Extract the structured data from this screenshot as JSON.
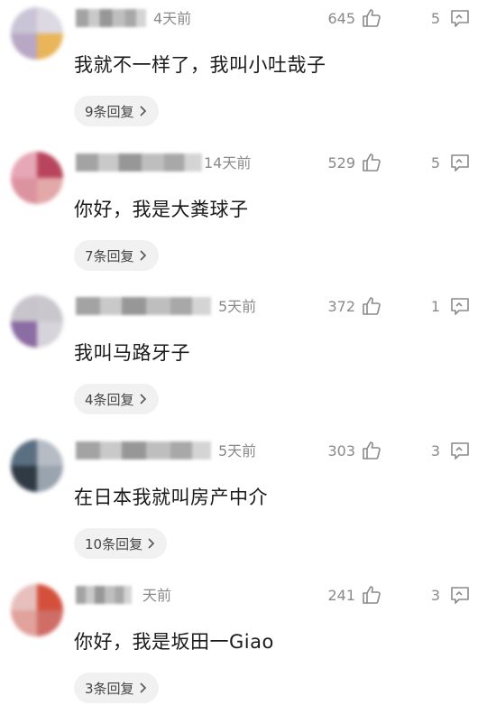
{
  "comments": [
    {
      "time": "4天前",
      "likes": "645",
      "reply_count": "5",
      "text": "我就不一样了，我叫小吐哉子",
      "replies_label": "9条回复",
      "avatar_colors": [
        "#c9c4d6",
        "#dcd9e2",
        "#b9a7c6",
        "#e9b55a"
      ]
    },
    {
      "time": "14天前",
      "likes": "529",
      "reply_count": "5",
      "text": "你好，我是大粪球子",
      "replies_label": "7条回复",
      "avatar_colors": [
        "#e6a7b6",
        "#b9455d",
        "#dc93a0",
        "#e3a8a8"
      ]
    },
    {
      "time": "5天前",
      "likes": "372",
      "reply_count": "1",
      "text": "我叫马路牙子",
      "replies_label": "4条回复",
      "avatar_colors": [
        "#c8c4cc",
        "#c9c6cc",
        "#8b6ca3",
        "#d6d3db"
      ]
    },
    {
      "time": "5天前",
      "likes": "303",
      "reply_count": "3",
      "text": "在日本我就叫房产中介",
      "replies_label": "10条回复",
      "avatar_colors": [
        "#5a6f82",
        "#b5bcc4",
        "#2f3a44",
        "#9aa4ae"
      ]
    },
    {
      "time": "天前",
      "likes": "241",
      "reply_count": "3",
      "text": "你好，我是坂田一Giao",
      "replies_label": "3条回复",
      "avatar_colors": [
        "#e7c0bd",
        "#d4503c",
        "#e0a29b",
        "#cf6d66"
      ]
    }
  ]
}
